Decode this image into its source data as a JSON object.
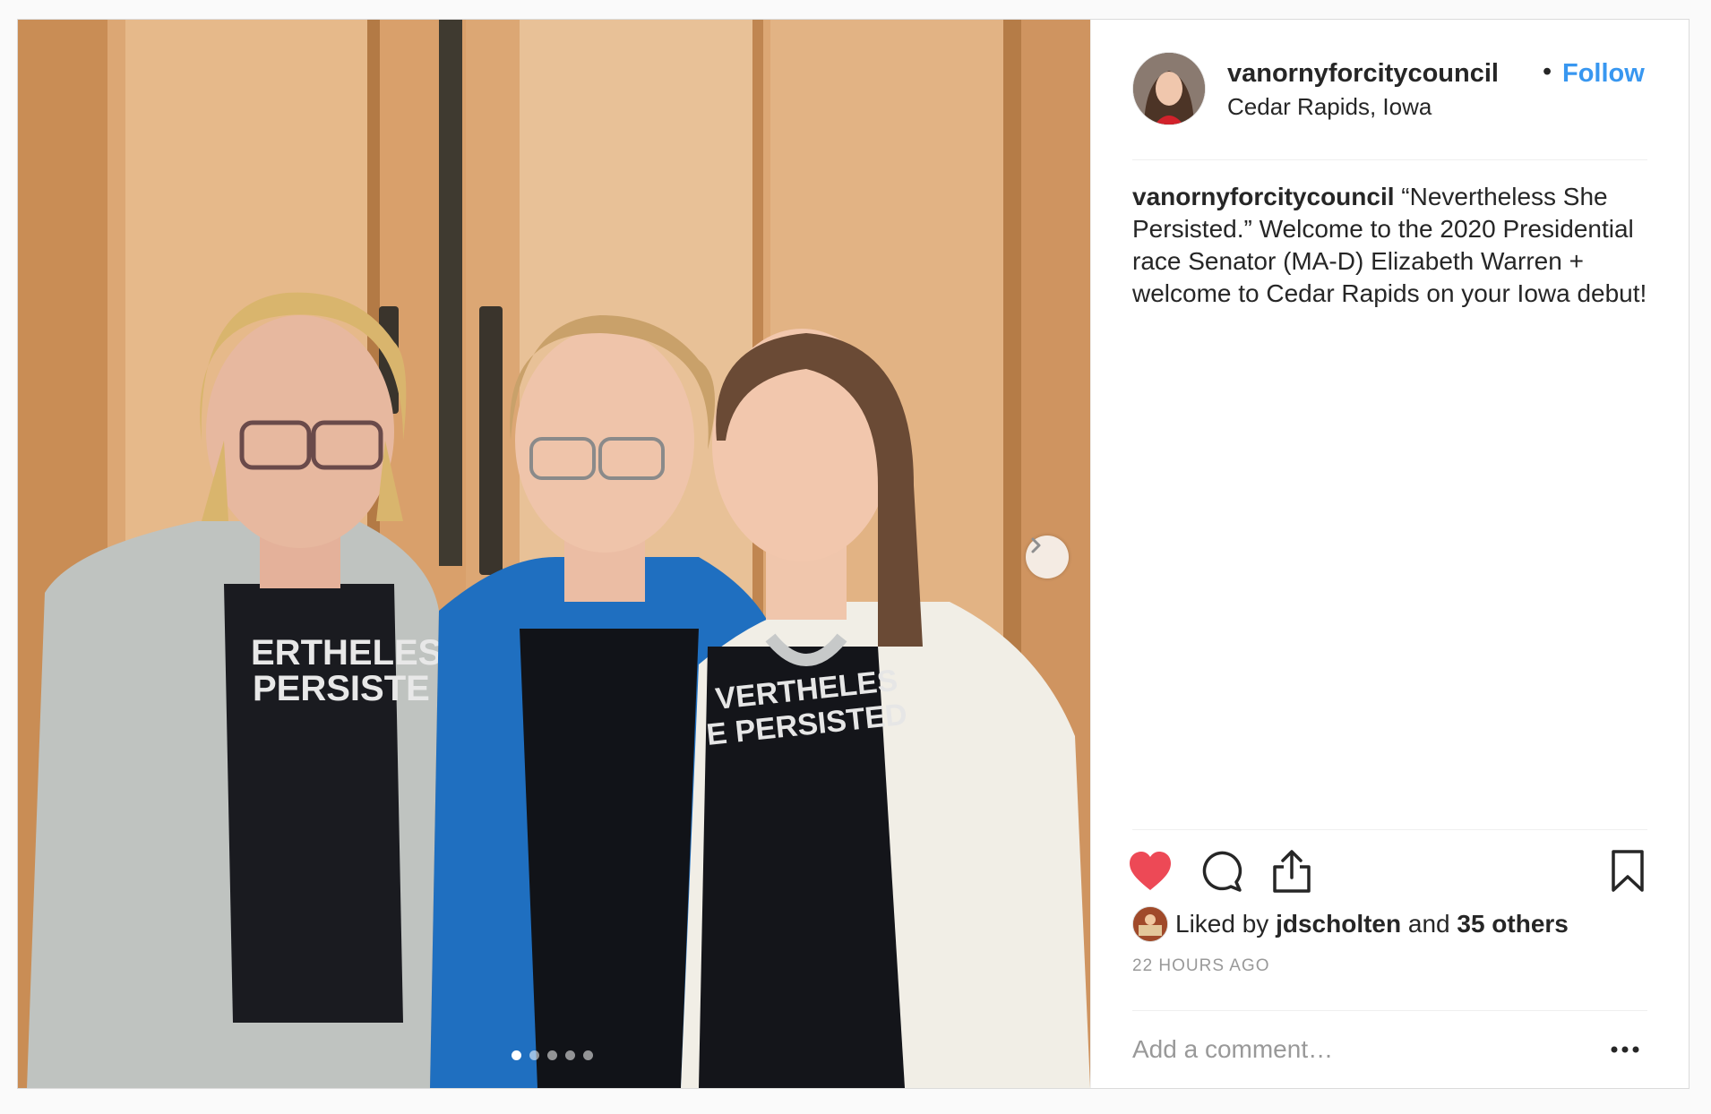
{
  "post": {
    "username": "vanornyforcitycouncil",
    "bullet": "•",
    "follow_label": "Follow",
    "location": "Cedar Rapids, Iowa",
    "caption_user": "vanornyforcitycouncil",
    "caption_text": "“Nevertheless She Persisted.” Welcome to the 2020 Presidential race Senator (MA-D) Elizabeth Warren + welcome to Cedar Rapids on your Iowa debut!",
    "photo_shirt_text_1": "ERTHELES",
    "photo_shirt_text_2": "PERSISTE",
    "photo_shirt_text_3": "VERTHELES",
    "photo_shirt_text_4": "E PERSISTED",
    "carousel": {
      "count": 5,
      "active_index": 1
    }
  },
  "likes": {
    "prefix": "Liked by",
    "user": "jdscholten",
    "and": "and",
    "others": "35 others"
  },
  "time_ago": "22 HOURS AGO",
  "comment": {
    "placeholder": "Add a comment…"
  },
  "icons": {
    "like": "heart-filled-icon",
    "comment": "comment-bubble-icon",
    "share": "share-upload-icon",
    "save": "bookmark-icon",
    "next": "chevron-right-icon",
    "more": "more-options-icon"
  },
  "colors": {
    "like_red": "#ed4956",
    "follow_blue": "#3897f0",
    "text": "#262626",
    "muted": "#999999"
  }
}
